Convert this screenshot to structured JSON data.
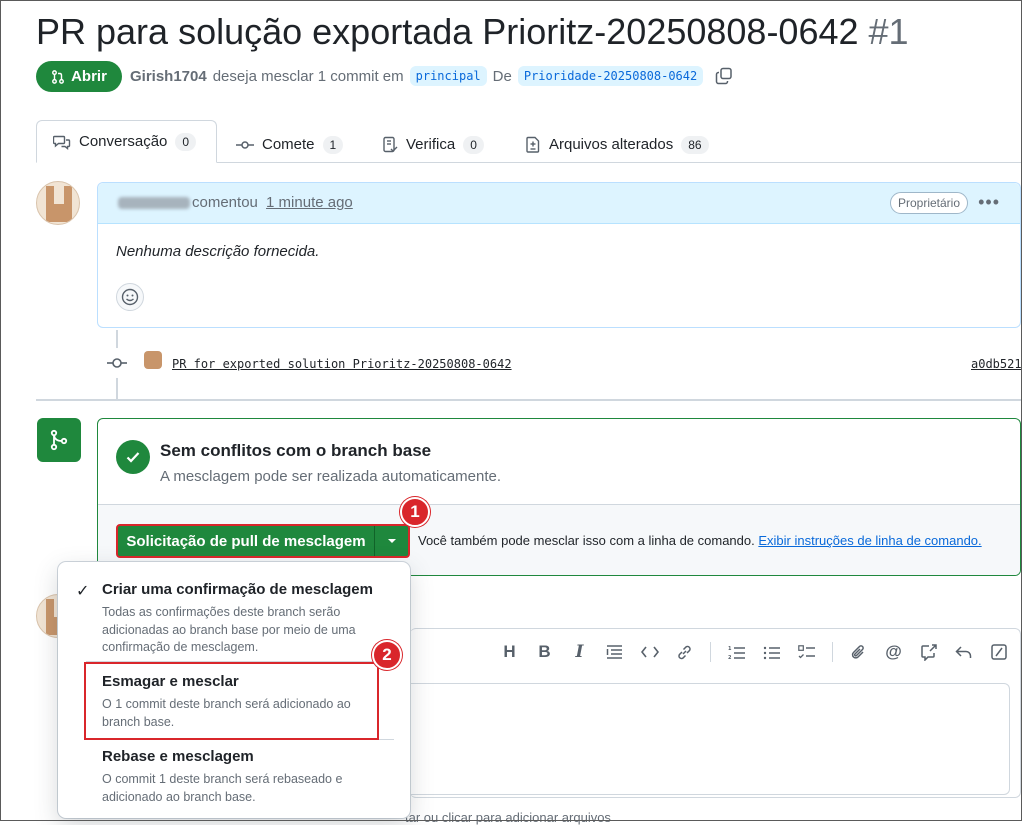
{
  "header": {
    "title": "PR para solução exportada Prioritz-20250808-0642",
    "number": "#1",
    "state": "Abrir",
    "author": "Girish1704",
    "merge_text": "deseja mesclar 1 commit em",
    "base_branch": "principal",
    "from_text": "De",
    "head_branch": "Prioridade-20250808-0642"
  },
  "tabs": [
    {
      "label": "Conversação",
      "count": "0",
      "icon": "conversation-icon"
    },
    {
      "label": "Comete",
      "count": "1",
      "icon": "commit-icon"
    },
    {
      "label": "Verifica",
      "count": "0",
      "icon": "checks-icon"
    },
    {
      "label": "Arquivos alterados",
      "count": "86",
      "icon": "file-diff-icon"
    }
  ],
  "comment": {
    "commented": "comentou",
    "time": "1 minute ago",
    "badge": "Proprietário",
    "body": "Nenhuma descrição fornecida."
  },
  "commit": {
    "message": "PR for exported solution Prioritz-20250808-0642",
    "sha": "a0db521"
  },
  "merge": {
    "title": "Sem conflitos com o branch base",
    "subtitle": "A mesclagem pode ser realizada automaticamente.",
    "button": "Solicitação de pull de mesclagem",
    "help": "Você também pode mesclar isso com a linha de comando.",
    "help_link": "Exibir instruções de linha de comando."
  },
  "menu": {
    "items": [
      {
        "title": "Criar uma confirmação de mesclagem",
        "desc": "Todas as confirmações deste branch serão adicionadas ao branch base por meio de uma confirmação de mesclagem.",
        "checked": true
      },
      {
        "title": "Esmagar e mesclar",
        "desc": "O 1 commit deste branch será adicionado ao branch base.",
        "checked": false
      },
      {
        "title": "Rebase e mesclagem",
        "desc": "O commit 1 deste branch será rebaseado e adicionado ao branch base.",
        "checked": false
      }
    ]
  },
  "annotations": {
    "step1": "1",
    "step2": "2"
  },
  "editor": {
    "toolbar": [
      "heading-icon",
      "bold-icon",
      "italic-icon",
      "quote-icon",
      "code-icon",
      "link-icon",
      "ordered-list-icon",
      "unordered-list-icon",
      "task-list-icon",
      "attach-icon",
      "mention-icon",
      "reference-icon",
      "reply-icon",
      "slash-icon"
    ],
    "drop_note": "tar ou clicar para adicionar arquivos"
  },
  "colors": {
    "green": "#1f883d",
    "red_annotation": "#d9262b",
    "link": "#0969da"
  }
}
